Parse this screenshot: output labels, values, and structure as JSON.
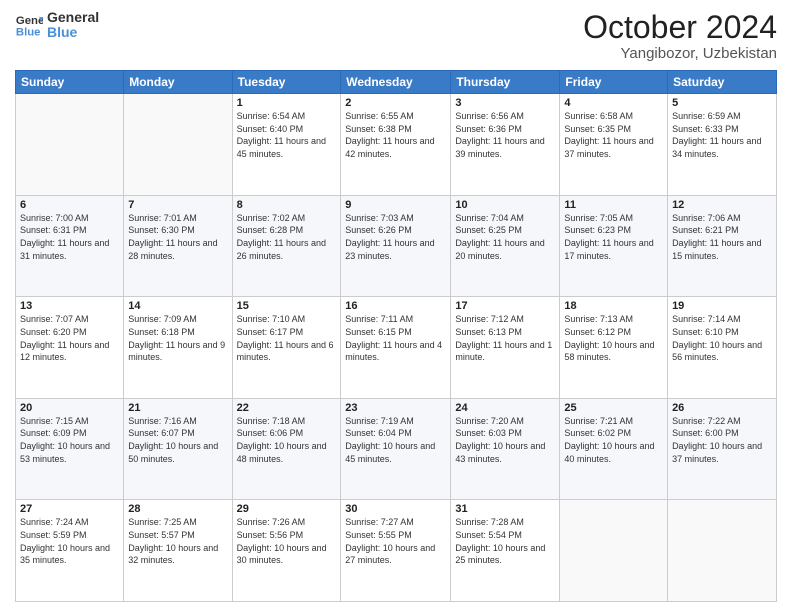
{
  "header": {
    "logo_line1": "General",
    "logo_line2": "Blue",
    "month": "October 2024",
    "location": "Yangibozor, Uzbekistan"
  },
  "weekdays": [
    "Sunday",
    "Monday",
    "Tuesday",
    "Wednesday",
    "Thursday",
    "Friday",
    "Saturday"
  ],
  "weeks": [
    [
      {
        "day": "",
        "sunrise": "",
        "sunset": "",
        "daylight": ""
      },
      {
        "day": "",
        "sunrise": "",
        "sunset": "",
        "daylight": ""
      },
      {
        "day": "1",
        "sunrise": "Sunrise: 6:54 AM",
        "sunset": "Sunset: 6:40 PM",
        "daylight": "Daylight: 11 hours and 45 minutes."
      },
      {
        "day": "2",
        "sunrise": "Sunrise: 6:55 AM",
        "sunset": "Sunset: 6:38 PM",
        "daylight": "Daylight: 11 hours and 42 minutes."
      },
      {
        "day": "3",
        "sunrise": "Sunrise: 6:56 AM",
        "sunset": "Sunset: 6:36 PM",
        "daylight": "Daylight: 11 hours and 39 minutes."
      },
      {
        "day": "4",
        "sunrise": "Sunrise: 6:58 AM",
        "sunset": "Sunset: 6:35 PM",
        "daylight": "Daylight: 11 hours and 37 minutes."
      },
      {
        "day": "5",
        "sunrise": "Sunrise: 6:59 AM",
        "sunset": "Sunset: 6:33 PM",
        "daylight": "Daylight: 11 hours and 34 minutes."
      }
    ],
    [
      {
        "day": "6",
        "sunrise": "Sunrise: 7:00 AM",
        "sunset": "Sunset: 6:31 PM",
        "daylight": "Daylight: 11 hours and 31 minutes."
      },
      {
        "day": "7",
        "sunrise": "Sunrise: 7:01 AM",
        "sunset": "Sunset: 6:30 PM",
        "daylight": "Daylight: 11 hours and 28 minutes."
      },
      {
        "day": "8",
        "sunrise": "Sunrise: 7:02 AM",
        "sunset": "Sunset: 6:28 PM",
        "daylight": "Daylight: 11 hours and 26 minutes."
      },
      {
        "day": "9",
        "sunrise": "Sunrise: 7:03 AM",
        "sunset": "Sunset: 6:26 PM",
        "daylight": "Daylight: 11 hours and 23 minutes."
      },
      {
        "day": "10",
        "sunrise": "Sunrise: 7:04 AM",
        "sunset": "Sunset: 6:25 PM",
        "daylight": "Daylight: 11 hours and 20 minutes."
      },
      {
        "day": "11",
        "sunrise": "Sunrise: 7:05 AM",
        "sunset": "Sunset: 6:23 PM",
        "daylight": "Daylight: 11 hours and 17 minutes."
      },
      {
        "day": "12",
        "sunrise": "Sunrise: 7:06 AM",
        "sunset": "Sunset: 6:21 PM",
        "daylight": "Daylight: 11 hours and 15 minutes."
      }
    ],
    [
      {
        "day": "13",
        "sunrise": "Sunrise: 7:07 AM",
        "sunset": "Sunset: 6:20 PM",
        "daylight": "Daylight: 11 hours and 12 minutes."
      },
      {
        "day": "14",
        "sunrise": "Sunrise: 7:09 AM",
        "sunset": "Sunset: 6:18 PM",
        "daylight": "Daylight: 11 hours and 9 minutes."
      },
      {
        "day": "15",
        "sunrise": "Sunrise: 7:10 AM",
        "sunset": "Sunset: 6:17 PM",
        "daylight": "Daylight: 11 hours and 6 minutes."
      },
      {
        "day": "16",
        "sunrise": "Sunrise: 7:11 AM",
        "sunset": "Sunset: 6:15 PM",
        "daylight": "Daylight: 11 hours and 4 minutes."
      },
      {
        "day": "17",
        "sunrise": "Sunrise: 7:12 AM",
        "sunset": "Sunset: 6:13 PM",
        "daylight": "Daylight: 11 hours and 1 minute."
      },
      {
        "day": "18",
        "sunrise": "Sunrise: 7:13 AM",
        "sunset": "Sunset: 6:12 PM",
        "daylight": "Daylight: 10 hours and 58 minutes."
      },
      {
        "day": "19",
        "sunrise": "Sunrise: 7:14 AM",
        "sunset": "Sunset: 6:10 PM",
        "daylight": "Daylight: 10 hours and 56 minutes."
      }
    ],
    [
      {
        "day": "20",
        "sunrise": "Sunrise: 7:15 AM",
        "sunset": "Sunset: 6:09 PM",
        "daylight": "Daylight: 10 hours and 53 minutes."
      },
      {
        "day": "21",
        "sunrise": "Sunrise: 7:16 AM",
        "sunset": "Sunset: 6:07 PM",
        "daylight": "Daylight: 10 hours and 50 minutes."
      },
      {
        "day": "22",
        "sunrise": "Sunrise: 7:18 AM",
        "sunset": "Sunset: 6:06 PM",
        "daylight": "Daylight: 10 hours and 48 minutes."
      },
      {
        "day": "23",
        "sunrise": "Sunrise: 7:19 AM",
        "sunset": "Sunset: 6:04 PM",
        "daylight": "Daylight: 10 hours and 45 minutes."
      },
      {
        "day": "24",
        "sunrise": "Sunrise: 7:20 AM",
        "sunset": "Sunset: 6:03 PM",
        "daylight": "Daylight: 10 hours and 43 minutes."
      },
      {
        "day": "25",
        "sunrise": "Sunrise: 7:21 AM",
        "sunset": "Sunset: 6:02 PM",
        "daylight": "Daylight: 10 hours and 40 minutes."
      },
      {
        "day": "26",
        "sunrise": "Sunrise: 7:22 AM",
        "sunset": "Sunset: 6:00 PM",
        "daylight": "Daylight: 10 hours and 37 minutes."
      }
    ],
    [
      {
        "day": "27",
        "sunrise": "Sunrise: 7:24 AM",
        "sunset": "Sunset: 5:59 PM",
        "daylight": "Daylight: 10 hours and 35 minutes."
      },
      {
        "day": "28",
        "sunrise": "Sunrise: 7:25 AM",
        "sunset": "Sunset: 5:57 PM",
        "daylight": "Daylight: 10 hours and 32 minutes."
      },
      {
        "day": "29",
        "sunrise": "Sunrise: 7:26 AM",
        "sunset": "Sunset: 5:56 PM",
        "daylight": "Daylight: 10 hours and 30 minutes."
      },
      {
        "day": "30",
        "sunrise": "Sunrise: 7:27 AM",
        "sunset": "Sunset: 5:55 PM",
        "daylight": "Daylight: 10 hours and 27 minutes."
      },
      {
        "day": "31",
        "sunrise": "Sunrise: 7:28 AM",
        "sunset": "Sunset: 5:54 PM",
        "daylight": "Daylight: 10 hours and 25 minutes."
      },
      {
        "day": "",
        "sunrise": "",
        "sunset": "",
        "daylight": ""
      },
      {
        "day": "",
        "sunrise": "",
        "sunset": "",
        "daylight": ""
      }
    ]
  ]
}
